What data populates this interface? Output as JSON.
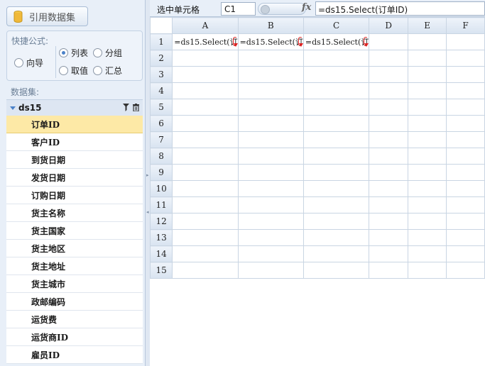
{
  "toolbar": {
    "ref_dataset_label": "引用数据集"
  },
  "quick_formula": {
    "title": "快捷公式:",
    "options": {
      "wizard": "向导",
      "list": "列表",
      "group": "分组",
      "value": "取值",
      "summary": "汇总"
    },
    "selected": "列表"
  },
  "dataset": {
    "section_title": "数据集:",
    "name": "ds15",
    "fields": [
      "订单ID",
      "客户ID",
      "到货日期",
      "发货日期",
      "订购日期",
      "货主名称",
      "货主国家",
      "货主地区",
      "货主地址",
      "货主城市",
      "政邮编码",
      "运货费",
      "运货商ID",
      "雇员ID"
    ],
    "selected_field": "订单ID"
  },
  "formula_bar": {
    "selected_cell_label": "选中单元格",
    "cell_ref": "C1",
    "fx_label": "fx",
    "formula": "=ds15.Select(订单ID)"
  },
  "grid": {
    "columns": [
      "A",
      "B",
      "C",
      "D",
      "E",
      "F"
    ],
    "rows": [
      "1",
      "2",
      "3",
      "4",
      "5",
      "6",
      "7",
      "8",
      "9",
      "10",
      "11",
      "12",
      "13",
      "14",
      "15"
    ],
    "cells": {
      "A1": "=ds15.Select(订",
      "B1": "=ds15.Select(订",
      "C1": "=ds15.Select(订"
    }
  },
  "colors": {
    "selected_field": "#fde9a6",
    "accent": "#4b82c9",
    "expand_marker": "#e02020"
  }
}
